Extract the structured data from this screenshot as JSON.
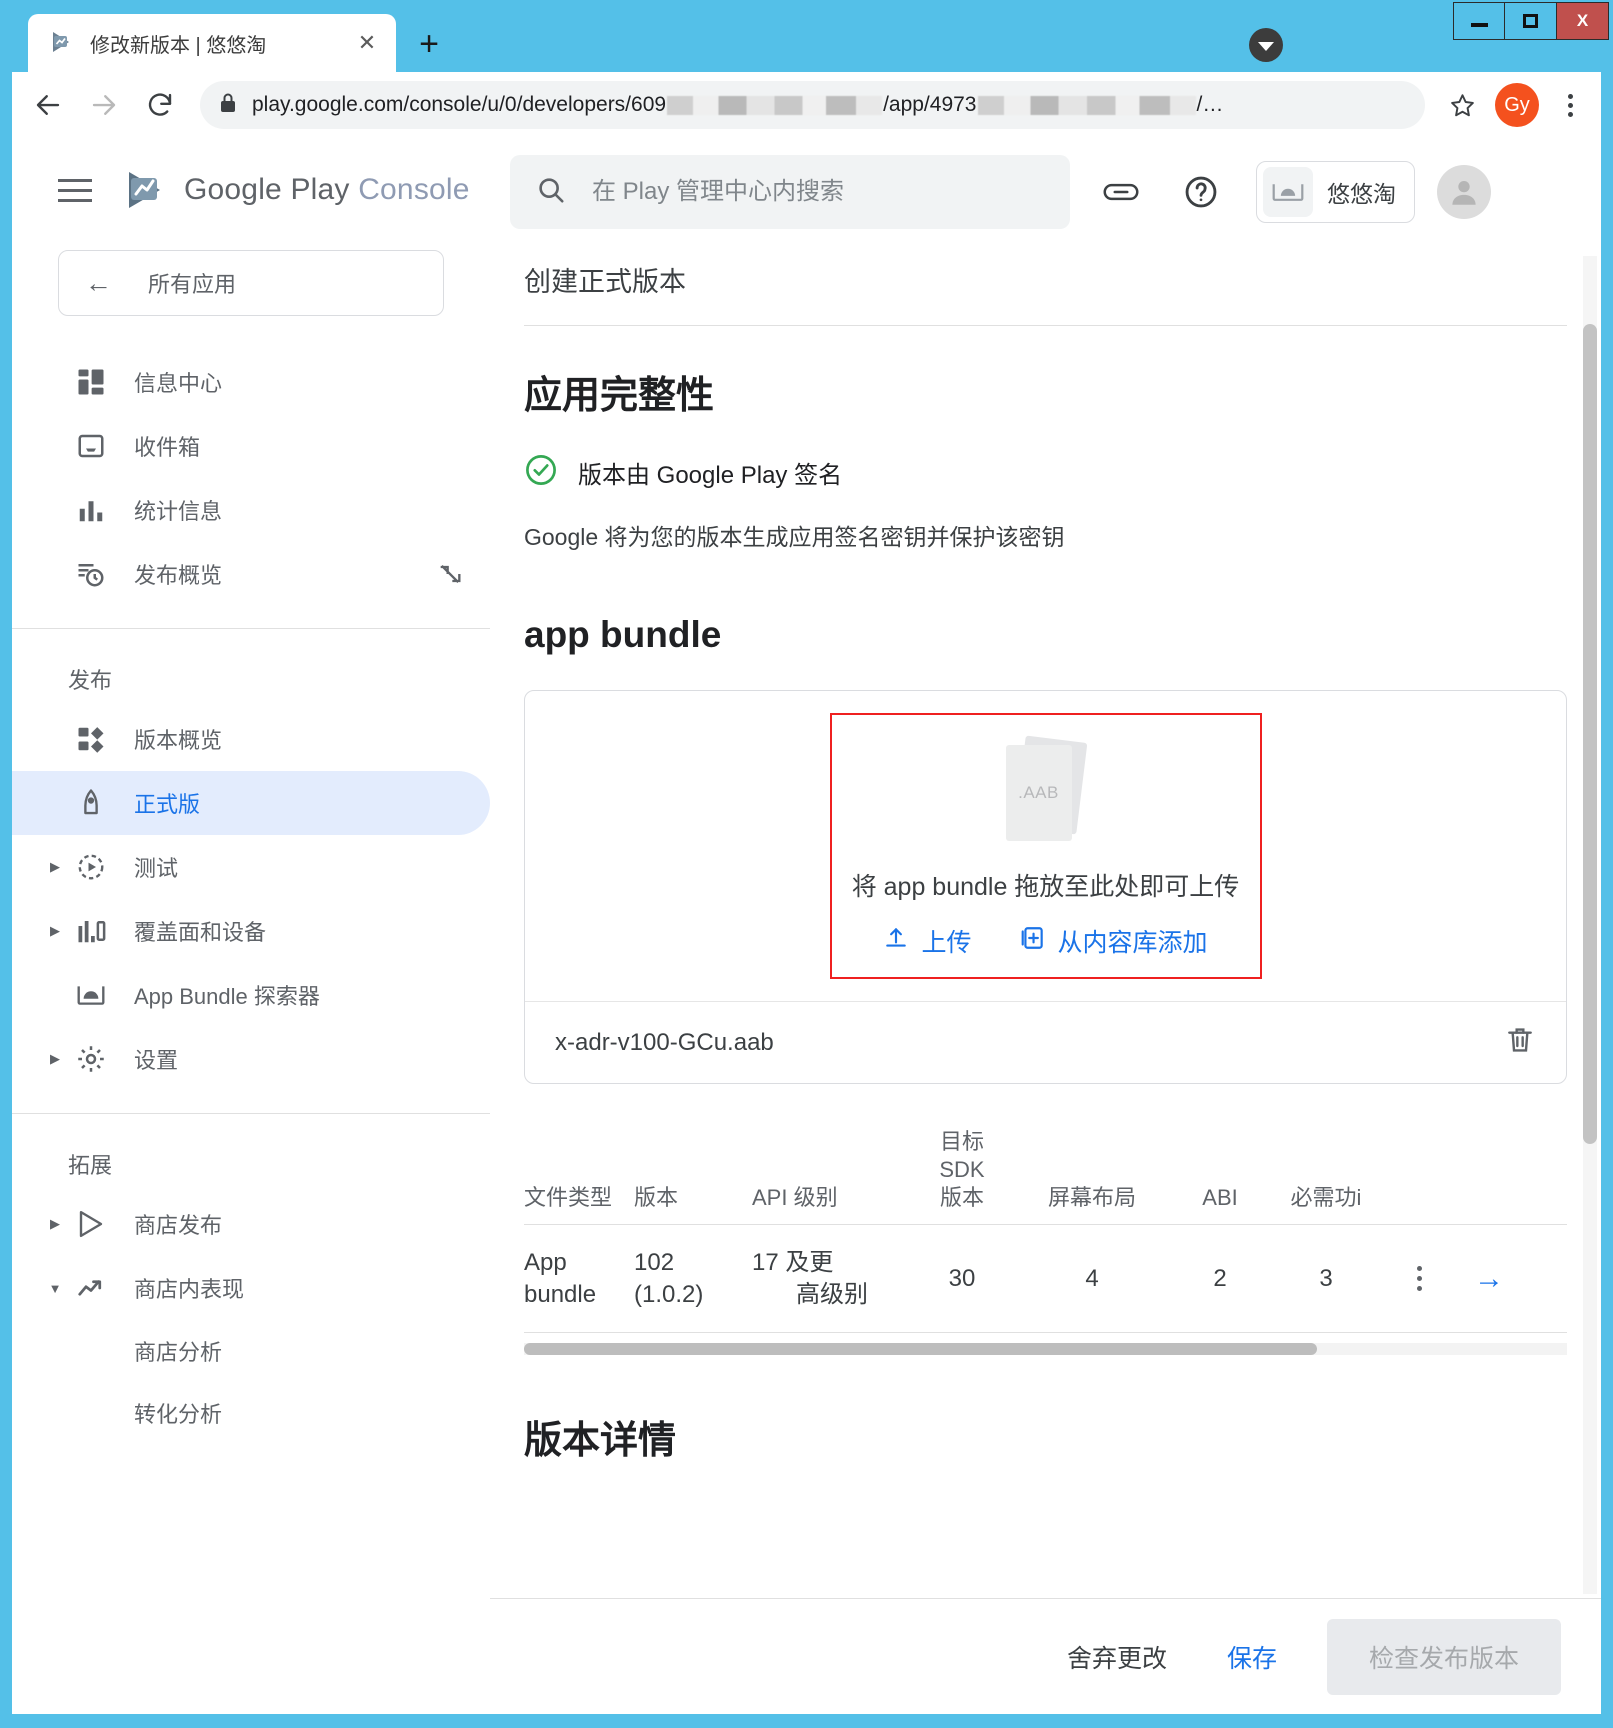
{
  "browser": {
    "tab": {
      "title": "修改新版本 | 悠悠淘",
      "close_label": "✕",
      "favicon": "play-console-favicon"
    },
    "new_tab_label": "+",
    "window_controls": {
      "minimize": "–",
      "maximize": "□",
      "close": "X"
    },
    "omnibox": {
      "url_prefix": "play.google.com/console/u/0/developers/609",
      "url_middle": "/app/4973",
      "url_suffix": "/…",
      "lock_icon": "lock-icon",
      "star_icon": "bookmark-star-icon"
    },
    "profile_initials": "Gy",
    "menu_icon": "kebab-menu-icon"
  },
  "sidebar": {
    "brand": {
      "name_1": "Google Play",
      "name_2": "Console",
      "logo": "play-console-logo"
    },
    "all_apps_label": "所有应用",
    "primary_items": [
      {
        "label": "信息中心",
        "icon": "dashboard-icon"
      },
      {
        "label": "收件箱",
        "icon": "inbox-icon"
      },
      {
        "label": "统计信息",
        "icon": "statistics-bar-icon"
      },
      {
        "label": "发布概览",
        "icon": "release-overview-icon",
        "trailing_icon": "crossed-eye-icon"
      }
    ],
    "section_release": "发布",
    "release_items": [
      {
        "label": "版本概览",
        "icon": "releases-overview-icon",
        "expandable": false,
        "selected": false
      },
      {
        "label": "正式版",
        "icon": "production-rocket-icon",
        "expandable": false,
        "selected": true
      },
      {
        "label": "测试",
        "icon": "testing-play-icon",
        "expandable": true,
        "selected": false
      },
      {
        "label": "覆盖面和设备",
        "icon": "reach-devices-icon",
        "expandable": true,
        "selected": false
      },
      {
        "label": "App Bundle 探索器",
        "icon": "android-bundle-icon",
        "expandable": false,
        "selected": false
      },
      {
        "label": "设置",
        "icon": "gear-icon",
        "expandable": true,
        "selected": false
      }
    ],
    "section_grow": "拓展",
    "grow_items": [
      {
        "label": "商店发布",
        "icon": "play-store-icon",
        "expandable": true,
        "expanded": false
      },
      {
        "label": "商店内表现",
        "icon": "trend-up-icon",
        "expandable": true,
        "expanded": true
      }
    ],
    "grow_subitems": [
      {
        "label": "商店分析"
      },
      {
        "label": "转化分析"
      }
    ]
  },
  "topbar": {
    "search_placeholder": "在 Play 管理中心内搜索",
    "search_value": "",
    "search_icon": "search-icon",
    "link_icon": "link-icon",
    "help_icon": "help-circle-icon",
    "account_chip": {
      "label": "悠悠淘",
      "icon": "android-head-icon"
    },
    "user_avatar": "user-avatar-icon"
  },
  "main": {
    "page_title": "创建正式版本",
    "integrity": {
      "heading": "应用完整性",
      "status_text": "版本由 Google Play 签名",
      "status_icon": "check-circle-icon",
      "description": "Google 将为您的版本生成应用签名密钥并保护该密钥"
    },
    "bundle": {
      "heading": "app bundle",
      "dropzone": {
        "file_badge": ".AAB",
        "text": "将 app bundle 拖放至此处即可上传",
        "upload_label": "上传",
        "upload_icon": "upload-icon",
        "library_label": "从内容库添加",
        "library_icon": "add-from-library-icon"
      },
      "uploaded_file": {
        "name": "x-adr-v100-GCu.aab",
        "delete_icon": "trash-icon"
      },
      "table": {
        "headers": [
          "文件类型",
          "版本",
          "API 级别",
          "目标\nSDK\n版本",
          "屏幕布局",
          "ABI",
          "必需功і"
        ],
        "header_cells": {
          "file_type": "文件类型",
          "version": "版本",
          "api_level": "API 级别",
          "target_sdk_l1": "目标",
          "target_sdk_l2": "SDK",
          "target_sdk_l3": "版本",
          "screen_layout": "屏幕布局",
          "abi": "ABI",
          "required_features": "必需功і"
        },
        "rows": [
          {
            "file_type_l1": "App",
            "file_type_l2": "bundle",
            "version_l1": "102",
            "version_l2": "(1.0.2)",
            "api_level_l1": "17 及更",
            "api_level_l2": "高级别",
            "target_sdk": "30",
            "screen_layout": "4",
            "abi": "2",
            "required_features": "3",
            "more_icon": "kebab-menu-icon",
            "expand_icon": "arrow-right-icon"
          }
        ]
      }
    },
    "release_details_heading": "版本详情"
  },
  "actionbar": {
    "discard_label": "舍弃更改",
    "save_label": "保存",
    "review_label": "检查发布版本"
  },
  "colors": {
    "accent_blue": "#1a73e8",
    "selected_nav_bg": "#e3ecfd",
    "dropzone_border_red": "#ef2020",
    "success_green": "#34a853",
    "window_chrome_blue": "#54c0e8",
    "profile_orange": "#f4511e",
    "close_button_red": "#c0504d"
  }
}
